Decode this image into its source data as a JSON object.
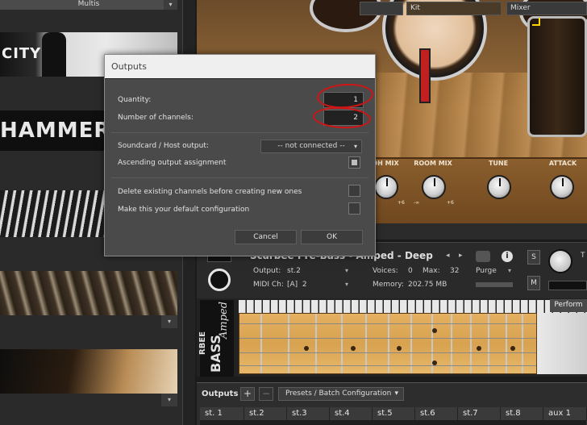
{
  "library": {
    "multis_label": "Multis",
    "city_text": "CITY",
    "hammers_text": "HAMMERS",
    "arrow_glyph": "▾"
  },
  "drum_kit": {
    "knobs": [
      {
        "label": "OH MIX",
        "range_low": "",
        "range_high": "+6"
      },
      {
        "label": "ROOM MIX",
        "range_low": "-∞",
        "range_high": "+6"
      },
      {
        "label": "TUNE",
        "range_low": "",
        "range_high": ""
      },
      {
        "label": "ATTACK",
        "range_low": "",
        "range_high": ""
      }
    ],
    "tabs": {
      "kit": "Kit",
      "mixer": "Mixer"
    }
  },
  "instrument": {
    "name": "Scarbee Pre-Bass - Amped - Deep",
    "output_label": "Output:",
    "output_value": "st.2",
    "midi_label": "MIDI Ch:",
    "midi_value": "[A]  2",
    "voices_label": "Voices:",
    "voices_value": "0",
    "max_label": "Max:",
    "max_value": "32",
    "memory_label": "Memory:",
    "memory_value": "202.75 MB",
    "purge_label": "Purge",
    "s_label": "S",
    "m_label": "M",
    "tune_short": "T",
    "perform_label": "Perform",
    "bass_brand": "RBEE",
    "bass_logo": "BASS",
    "bass_script": "Amped"
  },
  "dialog": {
    "title": "Outputs",
    "quantity_label": "Quantity:",
    "quantity_value": "1",
    "channels_label": "Number of channels:",
    "channels_value": "2",
    "soundcard_label": "Soundcard / Host output:",
    "soundcard_value": "-- not connected --",
    "ascending_label": "Ascending output assignment",
    "ascending_checked": true,
    "delete_label": "Delete existing channels before creating new ones",
    "delete_checked": false,
    "default_label": "Make this your default configuration",
    "default_checked": false,
    "cancel_label": "Cancel",
    "ok_label": "OK"
  },
  "outputs_panel": {
    "title": "Outputs",
    "add_label": "+",
    "remove_label": "−",
    "presets_label": "Presets / Batch Configuration",
    "channels": [
      "st. 1",
      "st.2",
      "st.3",
      "st.4",
      "st.5",
      "st.6",
      "st.7",
      "st.8",
      "aux 1"
    ]
  },
  "colors": {
    "annotation_red": "#d01414",
    "dialog_bg": "#4a4a4a",
    "fretboard": "#dca556"
  }
}
